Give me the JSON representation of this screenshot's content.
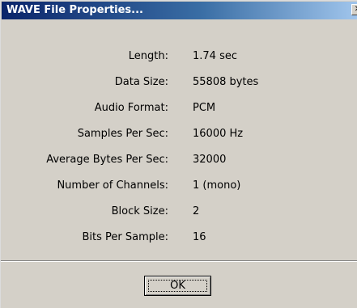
{
  "window": {
    "title": "WAVE File Properties...",
    "close_glyph": "✕"
  },
  "properties": [
    {
      "label": "Length:",
      "value": "1.74 sec"
    },
    {
      "label": "Data Size:",
      "value": "55808 bytes"
    },
    {
      "label": "Audio Format:",
      "value": "PCM"
    },
    {
      "label": "Samples Per Sec:",
      "value": "16000 Hz"
    },
    {
      "label": "Average Bytes Per Sec:",
      "value": "32000"
    },
    {
      "label": "Number of Channels:",
      "value": "1 (mono)"
    },
    {
      "label": "Block Size:",
      "value": "2"
    },
    {
      "label": "Bits Per Sample:",
      "value": "16"
    }
  ],
  "buttons": {
    "ok_label": "OK"
  }
}
